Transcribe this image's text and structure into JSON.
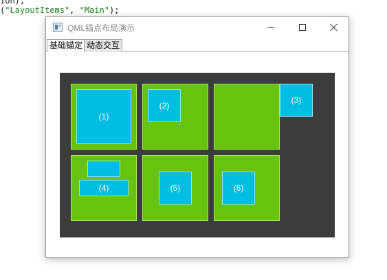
{
  "editor": {
    "line1": "ion);",
    "line2_prefix": "(",
    "line2_str1": "\"LayoutItems\"",
    "line2_sep": ", ",
    "line2_str2": "\"Main\"",
    "line2_suffix": ");"
  },
  "window": {
    "title": "QML锚点布局演示",
    "tabs": [
      {
        "label": "基础锚定",
        "active": true
      },
      {
        "label": "动态交互",
        "active": false
      }
    ]
  },
  "demo": {
    "canvas_color": "#3c3c3c",
    "cell_color": "#68c30f",
    "item_color": "#00bde4",
    "labels": {
      "item1": "(1)",
      "item2": "(2)",
      "item3": "(3)",
      "item4": "(4)",
      "item5": "(5)",
      "item6": "(6)"
    }
  }
}
